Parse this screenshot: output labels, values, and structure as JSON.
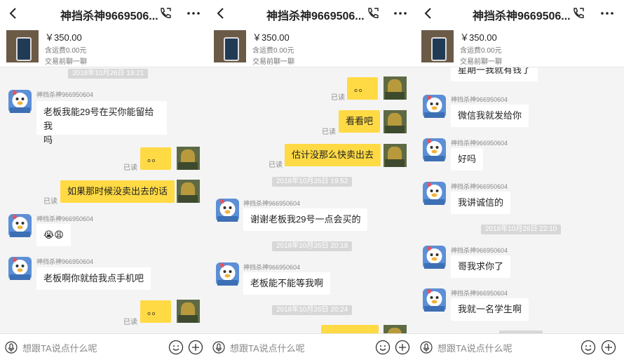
{
  "colors": {
    "accent": "#ffda44",
    "background": "#f4f4f4",
    "stamp": "#d7d7d7"
  },
  "icons": {
    "back": "chevron-left-icon",
    "phone": "phone-icon",
    "more": "more-icon",
    "mic": "microphone-icon",
    "emoji": "emoji-icon",
    "plus": "plus-icon"
  },
  "panes": [
    {
      "header": {
        "title": "神挡杀神9669506..."
      },
      "product": {
        "price": "￥350.00",
        "shipping": "含运费0.00元",
        "note": "交易前聊一聊"
      },
      "messages": {
        "t1": "2018年10月26日 19:21",
        "u1": "神挡杀神966950604",
        "m1a": "老板我能29号在买你能留给我",
        "m1b": "吗",
        "r1": "已读",
        "s1": "。。",
        "r2": "已读",
        "s2": "如果那时候没卖出去的话",
        "u2": "神挡杀神966950604",
        "m2": "😭😩",
        "u3": "神挡杀神966950604",
        "m3": "老板啊你就给我点手机吧",
        "r3": "已读",
        "s3": "。。"
      },
      "input": {
        "placeholder": "想跟TA说点什么呢"
      }
    },
    {
      "header": {
        "title": "神挡杀神9669506..."
      },
      "product": {
        "price": "￥350.00",
        "shipping": "含运费0.00元",
        "note": "交易前聊一聊"
      },
      "messages": {
        "r1": "已读",
        "s1": "。。",
        "r2": "已读",
        "s2": "看看吧",
        "r3": "已读",
        "s3": "估计没那么快卖出去",
        "t1": "2018年10月26日 19:52",
        "u1": "神挡杀神966950604",
        "m1": "谢谢老板我29号一点会买的",
        "t2": "2018年10月26日 20:18",
        "u2": "神挡杀神966950604",
        "m2": "老板能不能等我啊",
        "t3": "2018年10月26日 20:24"
      },
      "input": {
        "placeholder": "想跟TA说点什么呢"
      }
    },
    {
      "header": {
        "title": "神挡杀神9669506..."
      },
      "product": {
        "price": "￥350.00",
        "shipping": "含运费0.00元",
        "note": "交易前聊一聊"
      },
      "messages": {
        "m0": "星期一我就有钱了",
        "u1": "神挡杀神966950604",
        "m1": "微信我就发给你",
        "u2": "神挡杀神966950604",
        "m2": "好吗",
        "u3": "神挡杀神966950604",
        "m3": "我讲诚信的",
        "t1": "2018年10月26日 22:10",
        "u4": "神挡杀神966950604",
        "m4": "哥我求你了",
        "u5": "神挡杀神966950604",
        "m5": "我就一名学生啊"
      },
      "input": {
        "placeholder": "想跟TA说点什么呢"
      }
    }
  ]
}
